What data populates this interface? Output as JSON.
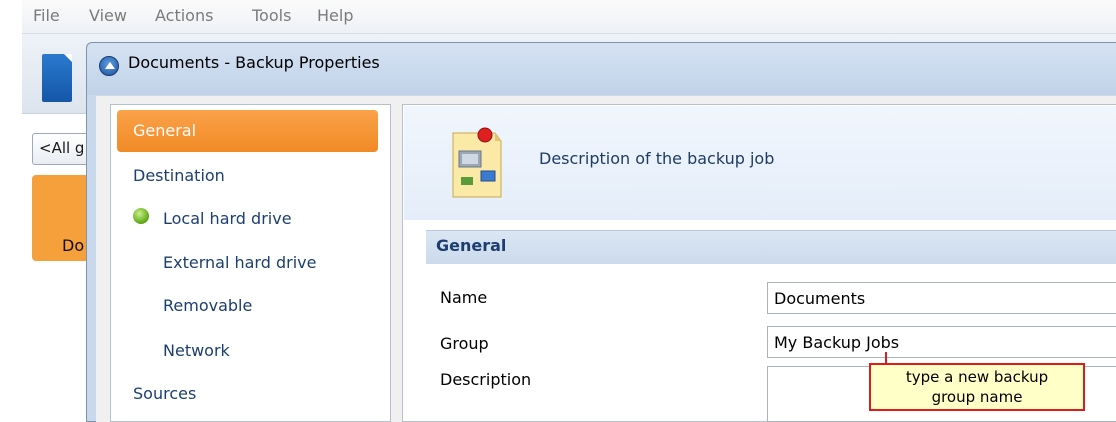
{
  "menu": {
    "items": [
      "File",
      "View",
      "Actions",
      "Tools",
      "Help"
    ]
  },
  "background": {
    "all_groups_label": "<All g",
    "tile_label": "Do"
  },
  "dialog": {
    "title": "Documents - Backup Properties"
  },
  "nav": {
    "general": "General",
    "destination": "Destination",
    "local_hard_drive": "Local hard drive",
    "external_hard_drive": "External hard drive",
    "removable": "Removable",
    "network": "Network",
    "sources": "Sources"
  },
  "content": {
    "header_text": "Description of the backup job",
    "section_title": "General",
    "name_label": "Name",
    "name_value": "Documents",
    "group_label": "Group",
    "group_value": "My Backup Jobs",
    "description_label": "Description"
  },
  "callout": {
    "line1": "type a new backup",
    "line2": "group name"
  },
  "colors": {
    "accent_orange": "#f5a03a",
    "nav_text": "#1c3f70",
    "callout_border": "#e01919",
    "callout_bg": "#ffffc7"
  }
}
